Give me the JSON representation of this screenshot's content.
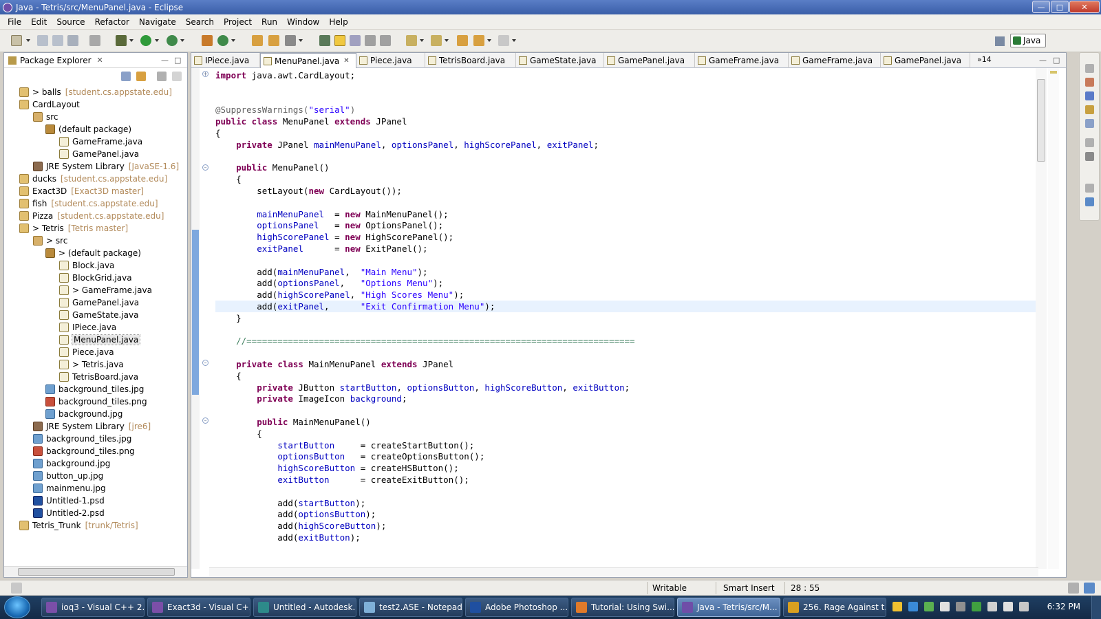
{
  "window": {
    "title": "Java - Tetris/src/MenuPanel.java - Eclipse"
  },
  "menu": [
    "File",
    "Edit",
    "Source",
    "Refactor",
    "Navigate",
    "Search",
    "Project",
    "Run",
    "Window",
    "Help"
  ],
  "perspective": "Java",
  "package_explorer": {
    "title": "Package Explorer",
    "tree": [
      {
        "label": "> balls",
        "ann": "[student.cs.appstate.edu]",
        "icon": "proj",
        "depth": 1
      },
      {
        "label": "CardLayout",
        "ann": "",
        "icon": "proj",
        "depth": 1
      },
      {
        "label": "src",
        "ann": "",
        "icon": "src",
        "depth": 2
      },
      {
        "label": "(default package)",
        "ann": "",
        "icon": "pkgi",
        "depth": 3
      },
      {
        "label": "GameFrame.java",
        "ann": "",
        "icon": "java",
        "depth": 4
      },
      {
        "label": "GamePanel.java",
        "ann": "",
        "icon": "java",
        "depth": 4
      },
      {
        "label": "JRE System Library",
        "ann": "[JavaSE-1.6]",
        "icon": "lib",
        "depth": 2
      },
      {
        "label": "ducks",
        "ann": "[student.cs.appstate.edu]",
        "icon": "proj",
        "depth": 1
      },
      {
        "label": "Exact3D",
        "ann": "[Exact3D master]",
        "icon": "proj",
        "depth": 1
      },
      {
        "label": "fish",
        "ann": "[student.cs.appstate.edu]",
        "icon": "proj",
        "depth": 1
      },
      {
        "label": "Pizza",
        "ann": "[student.cs.appstate.edu]",
        "icon": "proj",
        "depth": 1
      },
      {
        "label": "> Tetris",
        "ann": "[Tetris master]",
        "icon": "proj",
        "depth": 1
      },
      {
        "label": "> src",
        "ann": "",
        "icon": "src",
        "depth": 2
      },
      {
        "label": "> (default package)",
        "ann": "",
        "icon": "pkgi",
        "depth": 3
      },
      {
        "label": "Block.java",
        "ann": "",
        "icon": "java",
        "depth": 4
      },
      {
        "label": "BlockGrid.java",
        "ann": "",
        "icon": "java",
        "depth": 4
      },
      {
        "label": "> GameFrame.java",
        "ann": "",
        "icon": "java",
        "depth": 4
      },
      {
        "label": "GamePanel.java",
        "ann": "",
        "icon": "java",
        "depth": 4
      },
      {
        "label": "GameState.java",
        "ann": "",
        "icon": "java",
        "depth": 4
      },
      {
        "label": "IPiece.java",
        "ann": "",
        "icon": "java",
        "depth": 4
      },
      {
        "label": "MenuPanel.java",
        "ann": "",
        "icon": "java",
        "depth": 4,
        "selected": true
      },
      {
        "label": "Piece.java",
        "ann": "",
        "icon": "java",
        "depth": 4
      },
      {
        "label": "> Tetris.java",
        "ann": "",
        "icon": "java",
        "depth": 4
      },
      {
        "label": "TetrisBoard.java",
        "ann": "",
        "icon": "java",
        "depth": 4
      },
      {
        "label": "background_tiles.jpg",
        "ann": "",
        "icon": "img",
        "depth": 3
      },
      {
        "label": "background_tiles.png",
        "ann": "",
        "icon": "png",
        "depth": 3
      },
      {
        "label": "background.jpg",
        "ann": "",
        "icon": "img",
        "depth": 3
      },
      {
        "label": "JRE System Library",
        "ann": "[jre6]",
        "icon": "lib",
        "depth": 2
      },
      {
        "label": "background_tiles.jpg",
        "ann": "",
        "icon": "img",
        "depth": 2
      },
      {
        "label": "background_tiles.png",
        "ann": "",
        "icon": "png",
        "depth": 2
      },
      {
        "label": "background.jpg",
        "ann": "",
        "icon": "img",
        "depth": 2
      },
      {
        "label": "button_up.jpg",
        "ann": "",
        "icon": "img",
        "depth": 2
      },
      {
        "label": "mainmenu.jpg",
        "ann": "",
        "icon": "img",
        "depth": 2
      },
      {
        "label": "Untitled-1.psd",
        "ann": "",
        "icon": "psd",
        "depth": 2
      },
      {
        "label": "Untitled-2.psd",
        "ann": "",
        "icon": "psd",
        "depth": 2
      },
      {
        "label": "Tetris_Trunk",
        "ann": "[trunk/Tetris]",
        "icon": "proj",
        "depth": 1
      }
    ]
  },
  "editor": {
    "tabs": [
      "IPiece.java",
      "MenuPanel.java",
      "Piece.java",
      "TetrisBoard.java",
      "GameState.java",
      "GamePanel.java",
      "GameFrame.java",
      "GameFrame.java",
      "GamePanel.java"
    ],
    "active_tab": 1,
    "overflow_count": "14",
    "lines": [
      [
        [
          "kw",
          "import"
        ],
        [
          "t",
          " java.awt.CardLayout;"
        ]
      ],
      [],
      [],
      [
        [
          "ann-j",
          "@SuppressWarnings("
        ],
        [
          "str",
          "\"serial\""
        ],
        [
          "ann-j",
          ")"
        ]
      ],
      [
        [
          "kw",
          "public class"
        ],
        [
          "t",
          " MenuPanel "
        ],
        [
          "kw",
          "extends"
        ],
        [
          "t",
          " JPanel"
        ]
      ],
      [
        [
          "t",
          "{"
        ]
      ],
      [
        [
          "t",
          "    "
        ],
        [
          "kw",
          "private"
        ],
        [
          "t",
          " JPanel "
        ],
        [
          "fld",
          "mainMenuPanel"
        ],
        [
          "t",
          ", "
        ],
        [
          "fld",
          "optionsPanel"
        ],
        [
          "t",
          ", "
        ],
        [
          "fld",
          "highScorePanel"
        ],
        [
          "t",
          ", "
        ],
        [
          "fld",
          "exitPanel"
        ],
        [
          "t",
          ";"
        ]
      ],
      [],
      [
        [
          "t",
          "    "
        ],
        [
          "kw",
          "public"
        ],
        [
          "t",
          " MenuPanel()"
        ]
      ],
      [
        [
          "t",
          "    {"
        ]
      ],
      [
        [
          "t",
          "        setLayout("
        ],
        [
          "kw",
          "new"
        ],
        [
          "t",
          " CardLayout());"
        ]
      ],
      [],
      [
        [
          "t",
          "        "
        ],
        [
          "fld",
          "mainMenuPanel"
        ],
        [
          "t",
          "  = "
        ],
        [
          "kw",
          "new"
        ],
        [
          "t",
          " MainMenuPanel();"
        ]
      ],
      [
        [
          "t",
          "        "
        ],
        [
          "fld",
          "optionsPanel"
        ],
        [
          "t",
          "   = "
        ],
        [
          "kw",
          "new"
        ],
        [
          "t",
          " OptionsPanel();"
        ]
      ],
      [
        [
          "t",
          "        "
        ],
        [
          "fld",
          "highScorePanel"
        ],
        [
          "t",
          " = "
        ],
        [
          "kw",
          "new"
        ],
        [
          "t",
          " HighScorePanel();"
        ]
      ],
      [
        [
          "t",
          "        "
        ],
        [
          "fld",
          "exitPanel"
        ],
        [
          "t",
          "      = "
        ],
        [
          "kw",
          "new"
        ],
        [
          "t",
          " ExitPanel();"
        ]
      ],
      [],
      [
        [
          "t",
          "        add("
        ],
        [
          "fld",
          "mainMenuPanel"
        ],
        [
          "t",
          ",  "
        ],
        [
          "str",
          "\"Main Menu\""
        ],
        [
          "t",
          ");"
        ]
      ],
      [
        [
          "t",
          "        add("
        ],
        [
          "fld",
          "optionsPanel"
        ],
        [
          "t",
          ",   "
        ],
        [
          "str",
          "\"Options Menu\""
        ],
        [
          "t",
          ");"
        ]
      ],
      [
        [
          "t",
          "        add("
        ],
        [
          "fld",
          "highScorePanel"
        ],
        [
          "t",
          ", "
        ],
        [
          "str",
          "\"High Scores Menu\""
        ],
        [
          "t",
          ");"
        ]
      ],
      [
        [
          "t",
          "        add("
        ],
        [
          "fld",
          "exitPanel"
        ],
        [
          "t",
          ",      "
        ],
        [
          "str",
          "\"Exit Confirmation Menu\""
        ],
        [
          "t",
          ");"
        ]
      ],
      [
        [
          "t",
          "    }"
        ]
      ],
      [],
      [
        [
          "cmt",
          "    //==========================================================================="
        ]
      ],
      [],
      [
        [
          "t",
          "    "
        ],
        [
          "kw",
          "private class"
        ],
        [
          "t",
          " MainMenuPanel "
        ],
        [
          "kw",
          "extends"
        ],
        [
          "t",
          " JPanel"
        ]
      ],
      [
        [
          "t",
          "    {"
        ]
      ],
      [
        [
          "t",
          "        "
        ],
        [
          "kw",
          "private"
        ],
        [
          "t",
          " JButton "
        ],
        [
          "fld",
          "startButton"
        ],
        [
          "t",
          ", "
        ],
        [
          "fld",
          "optionsButton"
        ],
        [
          "t",
          ", "
        ],
        [
          "fld",
          "highScoreButton"
        ],
        [
          "t",
          ", "
        ],
        [
          "fld",
          "exitButton"
        ],
        [
          "t",
          ";"
        ]
      ],
      [
        [
          "t",
          "        "
        ],
        [
          "kw",
          "private"
        ],
        [
          "t",
          " ImageIcon "
        ],
        [
          "fld",
          "background"
        ],
        [
          "t",
          ";"
        ]
      ],
      [],
      [
        [
          "t",
          "        "
        ],
        [
          "kw",
          "public"
        ],
        [
          "t",
          " MainMenuPanel()"
        ]
      ],
      [
        [
          "t",
          "        {"
        ]
      ],
      [
        [
          "t",
          "            "
        ],
        [
          "fld",
          "startButton"
        ],
        [
          "t",
          "     = createStartButton();"
        ]
      ],
      [
        [
          "t",
          "            "
        ],
        [
          "fld",
          "optionsButton"
        ],
        [
          "t",
          "   = createOptionsButton();"
        ]
      ],
      [
        [
          "t",
          "            "
        ],
        [
          "fld",
          "highScoreButton"
        ],
        [
          "t",
          " = createHSButton();"
        ]
      ],
      [
        [
          "t",
          "            "
        ],
        [
          "fld",
          "exitButton"
        ],
        [
          "t",
          "      = createExitButton();"
        ]
      ],
      [],
      [
        [
          "t",
          "            add("
        ],
        [
          "fld",
          "startButton"
        ],
        [
          "t",
          ");"
        ]
      ],
      [
        [
          "t",
          "            add("
        ],
        [
          "fld",
          "optionsButton"
        ],
        [
          "t",
          ");"
        ]
      ],
      [
        [
          "t",
          "            add("
        ],
        [
          "fld",
          "highScoreButton"
        ],
        [
          "t",
          ");"
        ]
      ],
      [
        [
          "t",
          "            add("
        ],
        [
          "fld",
          "exitButton"
        ],
        [
          "t",
          ");"
        ]
      ]
    ],
    "current_line": 20
  },
  "status": {
    "writable": "Writable",
    "insert_mode": "Smart Insert",
    "position": "28 : 55"
  },
  "taskbar": {
    "tasks": [
      {
        "label": "ioq3 - Visual C++ 2...",
        "color": "#7b4fa8"
      },
      {
        "label": "Exact3d - Visual C+...",
        "color": "#7b4fa8"
      },
      {
        "label": "Untitled - Autodesk...",
        "color": "#2d8a8a"
      },
      {
        "label": "test2.ASE - Notepad",
        "color": "#7fb0d8"
      },
      {
        "label": "Adobe Photoshop ...",
        "color": "#1f4fa0"
      },
      {
        "label": "Tutorial: Using Swi...",
        "color": "#e07a2a"
      },
      {
        "label": "Java - Tetris/src/M...",
        "color": "#6f4ea8",
        "active": true
      },
      {
        "label": "256. Rage Against t...",
        "color": "#d9a020"
      }
    ],
    "clock": "6:32 PM"
  }
}
